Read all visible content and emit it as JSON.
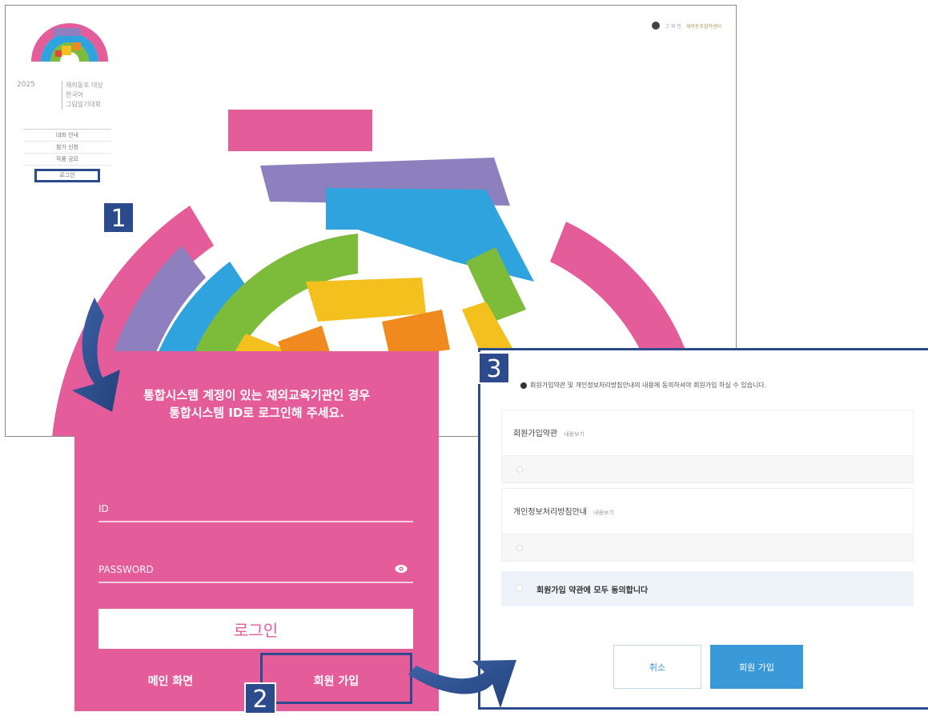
{
  "homepage": {
    "logo": {
      "year": "2025",
      "lines": [
        "재외동포 대상",
        "한국어",
        "그림일기대회"
      ]
    },
    "top_right": {
      "lang": "그 외 언",
      "org": "재외동포협력센터"
    },
    "nav": [
      {
        "label": "대회 안내"
      },
      {
        "label": "참가 신청"
      },
      {
        "label": "작품 공모"
      },
      {
        "label": "로그인"
      }
    ]
  },
  "steps": [
    "1",
    "2",
    "3"
  ],
  "login": {
    "message_line1": "통합시스템 계정이 있는 재외교육기관인 경우",
    "message_line2": "통합시스템 ID로 로그인해 주세요.",
    "id_placeholder": "ID",
    "password_placeholder": "PASSWORD",
    "login_button": "로그인",
    "main_link": "메인 화면",
    "signup_link": "회원 가입"
  },
  "signup": {
    "notice": "회원가입약관 및 개인정보처리방침안내의 내용에 동의하셔야 회원가입 하실 수 있습니다.",
    "terms": [
      {
        "title": "회원가입약관",
        "view": "내용보기"
      },
      {
        "title": "개인정보처리방침안내",
        "view": "내용보기"
      }
    ],
    "agree_all": "회원가입 약관에 모두 동의합니다",
    "cancel_button": "취소",
    "join_button": "회원 가입"
  },
  "colors": {
    "pink": "#e45c9a",
    "purple": "#8e7fbf",
    "blue": "#2ea3dd",
    "green": "#7dbb3b",
    "yellow": "#f3c01e",
    "orange": "#f08a1f",
    "red": "#e8463a",
    "callout": "#2b4b8c"
  }
}
